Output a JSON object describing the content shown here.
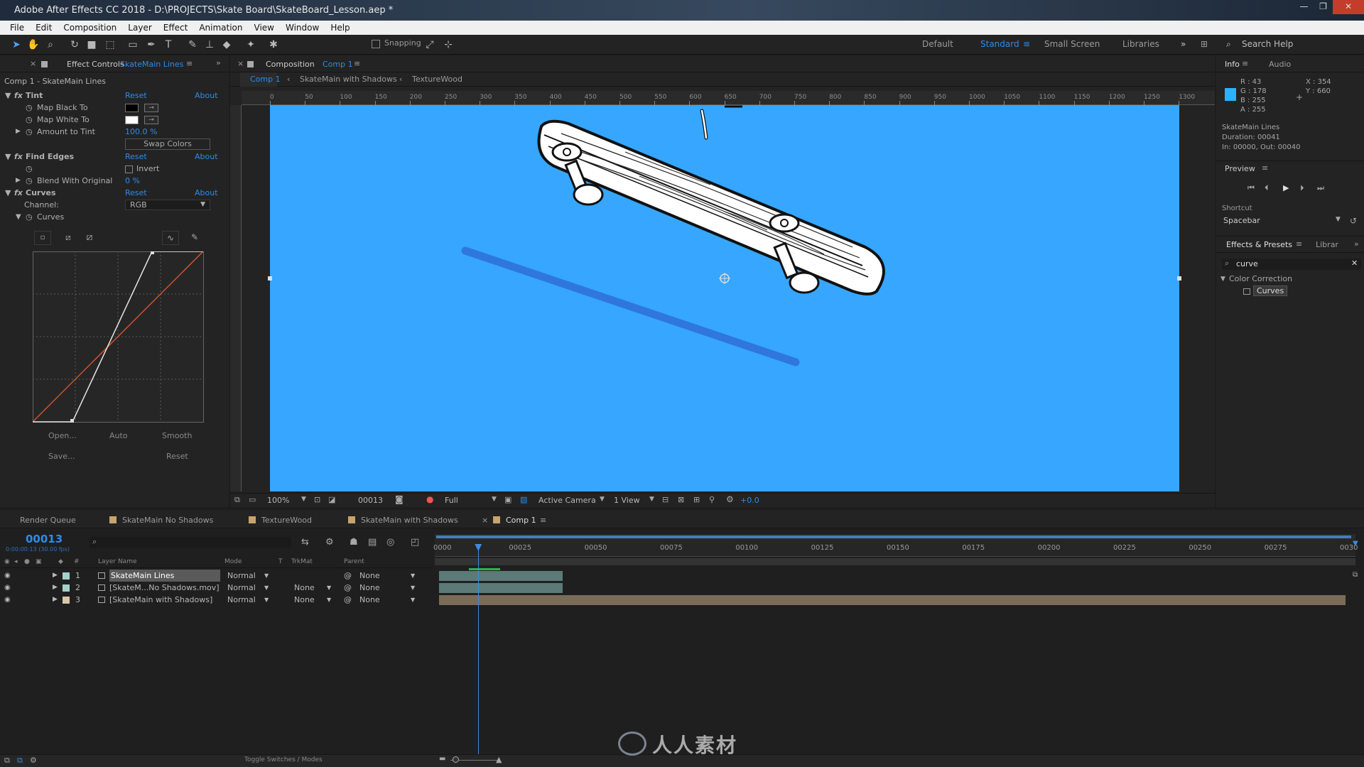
{
  "app": {
    "title": "Adobe After Effects CC 2018 - D:\\PROJECTS\\Skate Board\\SkateBoard_Lesson.aep *",
    "window_buttons": [
      "—",
      "❐",
      "✕"
    ]
  },
  "menu": [
    "File",
    "Edit",
    "Composition",
    "Layer",
    "Effect",
    "Animation",
    "View",
    "Window",
    "Help"
  ],
  "toolbar": {
    "snapping_label": "Snapping",
    "workspaces": [
      "Default",
      "Standard",
      "Small Screen",
      "Libraries"
    ],
    "active_workspace": "Standard",
    "search_help": "Search Help"
  },
  "effect_controls": {
    "tab_label": "Effect Controls",
    "tab_layer": "SkateMain Lines",
    "subtitle": "Comp 1 - SkateMain Lines",
    "reset": "Reset",
    "about": "About",
    "tint": {
      "name": "Tint",
      "map_black": "Map Black To",
      "map_white": "Map White To",
      "amount": "Amount to Tint",
      "amount_value": "100.0 %",
      "swap": "Swap Colors"
    },
    "find_edges": {
      "name": "Find Edges",
      "invert": "Invert",
      "blend": "Blend With Original",
      "blend_value": "0 %"
    },
    "curves": {
      "name": "Curves",
      "channel_label": "Channel:",
      "channel_value": "RGB",
      "curves_label": "Curves",
      "buttons": [
        "Open...",
        "Auto",
        "Smooth",
        "Save...",
        "Reset"
      ]
    }
  },
  "composition": {
    "panel_label": "Composition",
    "panel_comp": "Comp 1",
    "breadcrumbs": [
      "Comp 1",
      "SkateMain with Shadows",
      "TextureWood"
    ],
    "ruler": [
      "0",
      "50",
      "100",
      "150",
      "200",
      "250",
      "300",
      "350",
      "400",
      "450",
      "500",
      "550",
      "600",
      "650",
      "700",
      "750",
      "800",
      "850",
      "900",
      "950",
      "1000",
      "1050",
      "1100",
      "1150",
      "1200",
      "1250",
      "1300"
    ],
    "canvas_color": "#36a6ff",
    "viewer_bar": {
      "zoom": "100%",
      "timecode": "00013",
      "resolution": "Full",
      "camera": "Active Camera",
      "views": "1 View",
      "exposure": "+0.0"
    }
  },
  "info": {
    "tabs": [
      "Info",
      "Audio"
    ],
    "r": "R : 43",
    "g": "G : 178",
    "b": "B : 255",
    "a": "A : 255",
    "x": "X : 354",
    "y": "Y : 660",
    "swatch_color": "#2bb2ff",
    "layer": "SkateMain Lines",
    "duration": "Duration: 00041",
    "inout": "In: 00000, Out: 00040"
  },
  "preview": {
    "title": "Preview",
    "shortcut_label": "Shortcut",
    "shortcut_value": "Spacebar"
  },
  "effects_presets": {
    "tab": "Effects & Presets",
    "tab2": "Librar",
    "search": "curve",
    "category": "Color Correction",
    "item": "Curves"
  },
  "timeline": {
    "tabs": [
      "Render Queue",
      "SkateMain No Shadows",
      "TextureWood",
      "SkateMain with Shadows",
      "Comp 1"
    ],
    "tab_colors": [
      "#c8a46a",
      "#c8a46a",
      "#c8a46a",
      "#c8a46a"
    ],
    "timecode": "00013",
    "timecode_sub": "0:00:00:13 (30.00 fps)",
    "columns": {
      "layer_name": "Layer Name",
      "mode": "Mode",
      "t": "T",
      "trkmat": "TrkMat",
      "parent": "Parent"
    },
    "layers": [
      {
        "num": "1",
        "name": "SkateMain Lines",
        "mode": "Normal",
        "trkmat": "",
        "parent": "None",
        "color": "#a5d0c9"
      },
      {
        "num": "2",
        "name": "[SkateM...No Shadows.mov]",
        "mode": "Normal",
        "trkmat": "None",
        "parent": "None",
        "color": "#a5d0c9"
      },
      {
        "num": "3",
        "name": "[SkateMain with Shadows]",
        "mode": "Normal",
        "trkmat": "None",
        "parent": "None",
        "color": "#d8c7a8"
      }
    ],
    "ruler": [
      "0000",
      "00025",
      "00050",
      "00075",
      "00100",
      "00125",
      "00150",
      "00175",
      "00200",
      "00225",
      "00250",
      "00275",
      "0030"
    ],
    "toggle_label": "Toggle Switches / Modes",
    "playhead_frame": 13,
    "total_frames": 300
  },
  "watermark": "人人素材"
}
